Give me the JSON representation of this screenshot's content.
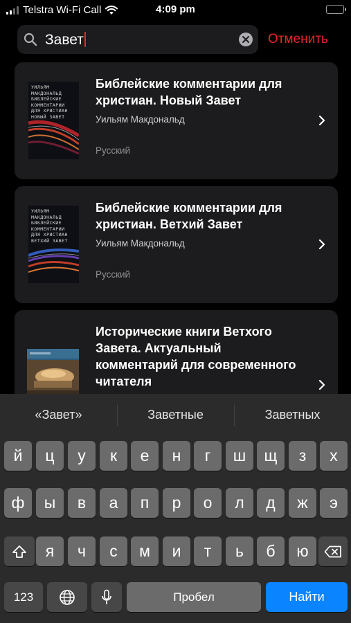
{
  "status_bar": {
    "carrier": "Telstra Wi-Fi Call",
    "time": "4:09 pm"
  },
  "search": {
    "query": "Завет",
    "cancel_label": "Отменить",
    "accent_color": "#e8262b"
  },
  "results": [
    {
      "title": "Библейские комментарии для христиан. Новый Завет",
      "author": "Уильям Макдональд",
      "language": "Русский",
      "cover_text": "Уильям Макдональд Библейские комментарии для христиан Новый Завет"
    },
    {
      "title": "Библейские комментарии для христиан. Ветхий Завет",
      "author": "Уильям Макдональд",
      "language": "Русский",
      "cover_text": "Уильям Макдональд Библейские комментарии для христиан Ветхий Завет"
    },
    {
      "title": "Исторические книги Ветхого Завета. Актуальный комментарий для современного читателя"
    }
  ],
  "keyboard": {
    "predictions": [
      "«Завет»",
      "Заветные",
      "Заветных"
    ],
    "row1": [
      "й",
      "ц",
      "у",
      "к",
      "е",
      "н",
      "г",
      "ш",
      "щ",
      "з",
      "х"
    ],
    "row2": [
      "ф",
      "ы",
      "в",
      "а",
      "п",
      "р",
      "о",
      "л",
      "д",
      "ж",
      "э"
    ],
    "row3": [
      "я",
      "ч",
      "с",
      "м",
      "и",
      "т",
      "ь",
      "б",
      "ю"
    ],
    "numbers_label": "123",
    "space_label": "Пробел",
    "go_label": "Найти",
    "icons": [
      "shift-icon",
      "backspace-icon",
      "globe-icon",
      "microphone-icon"
    ]
  }
}
